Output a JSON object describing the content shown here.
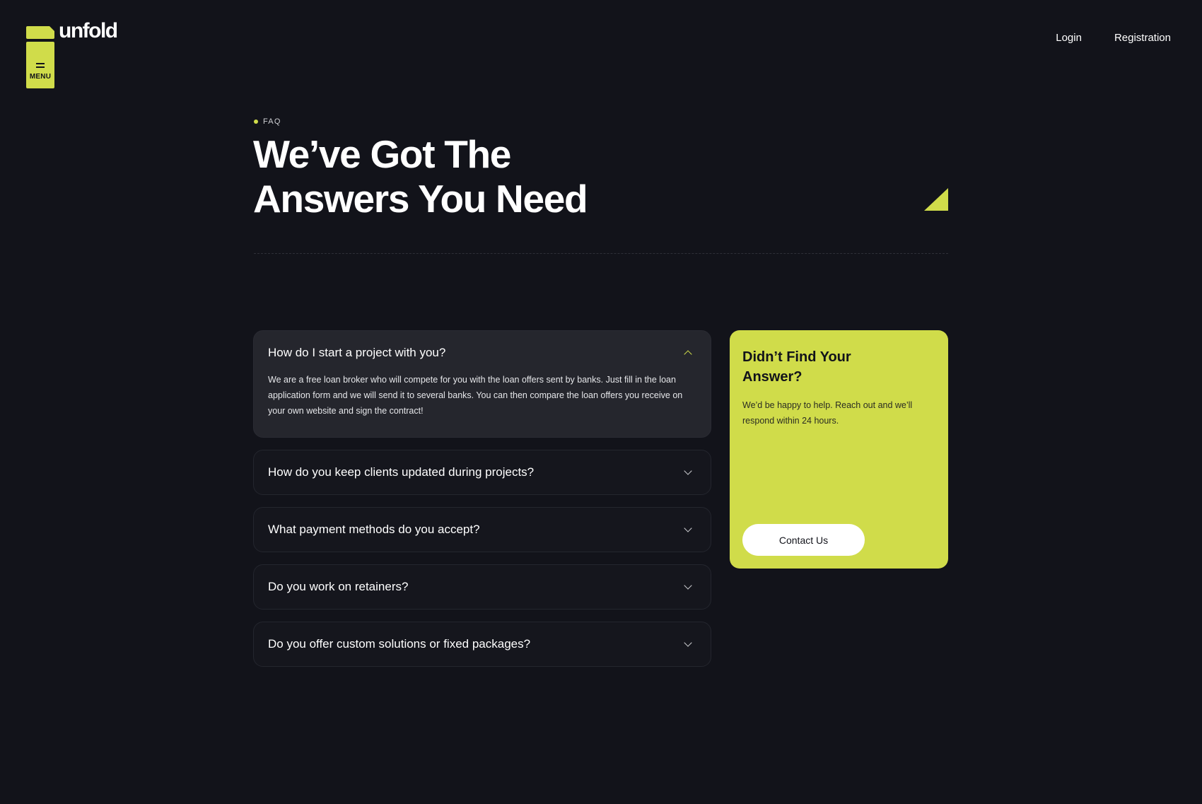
{
  "brand": {
    "name": "unfold",
    "accent_color": "#d0dc4a",
    "background_color": "#12131a"
  },
  "menu": {
    "label": "MENU",
    "icon": "hamburger-icon"
  },
  "nav": {
    "login": "Login",
    "registration": "Registration"
  },
  "hero": {
    "eyebrow": "FAQ",
    "title_line1": "We’ve Got The",
    "title_line2": "Answers You Need"
  },
  "faq": {
    "items": [
      {
        "question": "How do I start a project with you?",
        "answer": "We are a free loan broker who will compete for you with the loan offers sent by banks. Just fill in the loan application form and we will send it to several banks. You can then compare the loan offers you receive on your own website and sign the contract!",
        "expanded": true
      },
      {
        "question": "How do you keep clients updated during projects?",
        "expanded": false
      },
      {
        "question": "What payment methods do you accept?",
        "expanded": false
      },
      {
        "question": "Do you work on retainers?",
        "expanded": false
      },
      {
        "question": "Do you offer custom solutions or fixed packages?",
        "expanded": false
      }
    ]
  },
  "cta": {
    "title": "Didn’t Find Your Answer?",
    "text": "We’d be happy to help. Reach out and we’ll respond within 24 hours.",
    "button_label": "Contact Us"
  }
}
